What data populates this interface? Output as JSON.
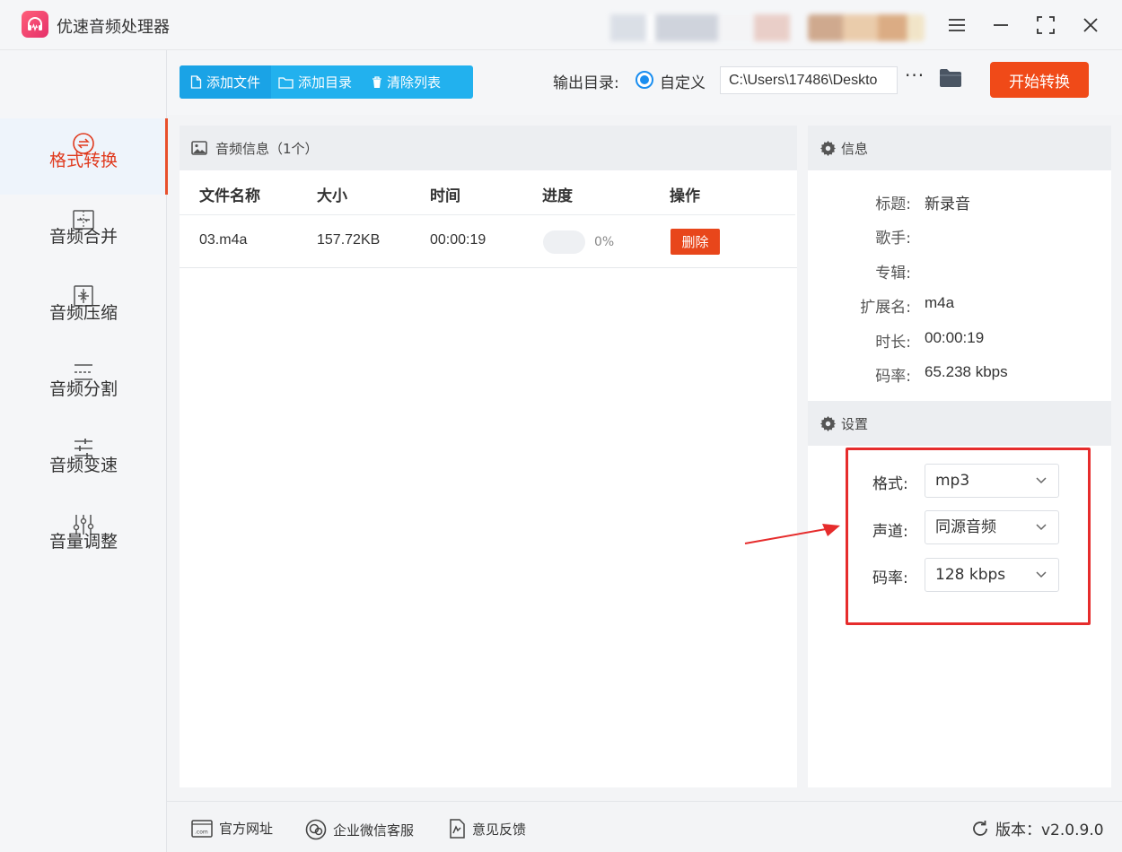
{
  "app": {
    "title": "优速音频处理器"
  },
  "window_controls": [
    "menu-icon",
    "minimize-icon",
    "maximize-icon",
    "close-icon"
  ],
  "sidebar": {
    "items": [
      {
        "label": "格式转换",
        "icon": "convert-icon",
        "active": true
      },
      {
        "label": "音频合并",
        "icon": "merge-icon"
      },
      {
        "label": "音频压缩",
        "icon": "compress-icon"
      },
      {
        "label": "音频分割",
        "icon": "split-icon"
      },
      {
        "label": "音频变速",
        "icon": "speed-icon"
      },
      {
        "label": "音量调整",
        "icon": "volume-icon"
      }
    ]
  },
  "toolbar": {
    "add_file": "添加文件",
    "add_folder": "添加目录",
    "clear_list": "清除列表",
    "output_label": "输出目录:",
    "custom_option": "自定义",
    "output_path": "C:\\Users\\17486\\Deskto",
    "more": "···",
    "start_button": "开始转换"
  },
  "file_list": {
    "title": "音频信息（1个）",
    "columns": [
      "文件名称",
      "大小",
      "时间",
      "进度",
      "操作"
    ],
    "rows": [
      {
        "name": "03.m4a",
        "size": "157.72KB",
        "time": "00:00:19",
        "progress": 0,
        "progress_text": "0%",
        "action": "删除"
      }
    ]
  },
  "info": {
    "title": "信息",
    "fields": [
      {
        "label": "标题:",
        "value": "新录音"
      },
      {
        "label": "歌手:",
        "value": ""
      },
      {
        "label": "专辑:",
        "value": ""
      },
      {
        "label": "扩展名:",
        "value": "m4a"
      },
      {
        "label": "时长:",
        "value": "00:00:19"
      },
      {
        "label": "码率:",
        "value": "65.238 kbps"
      }
    ]
  },
  "settings": {
    "title": "设置",
    "fields": [
      {
        "label": "格式:",
        "value": "mp3"
      },
      {
        "label": "声道:",
        "value": "同源音频"
      },
      {
        "label": "码率:",
        "value": "128 kbps"
      }
    ]
  },
  "statusbar": {
    "website": "官方网址",
    "wechat": "企业微信客服",
    "feedback": "意见反馈",
    "version": "版本：v2.0.9.0"
  },
  "colors": {
    "accent_blue": "#22b1ee",
    "accent_red": "#f04a18",
    "highlight_red": "#e62c2c"
  }
}
